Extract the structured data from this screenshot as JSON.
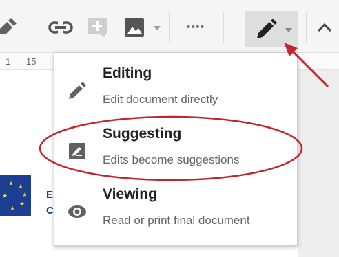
{
  "toolbar": {
    "icons": [
      "pencil-partial-icon",
      "link-icon",
      "add-comment-icon",
      "image-icon",
      "more-icon",
      "editing-mode-icon",
      "collapse-icon"
    ],
    "more_label": "••••"
  },
  "ruler": {
    "marks": [
      "1",
      "15"
    ]
  },
  "document": {
    "peek_lines": [
      "E",
      "C"
    ]
  },
  "mode_menu": {
    "items": [
      {
        "title": "Editing",
        "description": "Edit document directly",
        "icon": "pencil-icon"
      },
      {
        "title": "Suggesting",
        "description": "Edits become suggestions",
        "icon": "suggest-edit-icon"
      },
      {
        "title": "Viewing",
        "description": "Read or print final document",
        "icon": "eye-icon"
      }
    ]
  },
  "colors": {
    "annotation": "#c0262b",
    "menu_title": "#222222",
    "menu_desc": "#666666",
    "icon": "#616161"
  }
}
